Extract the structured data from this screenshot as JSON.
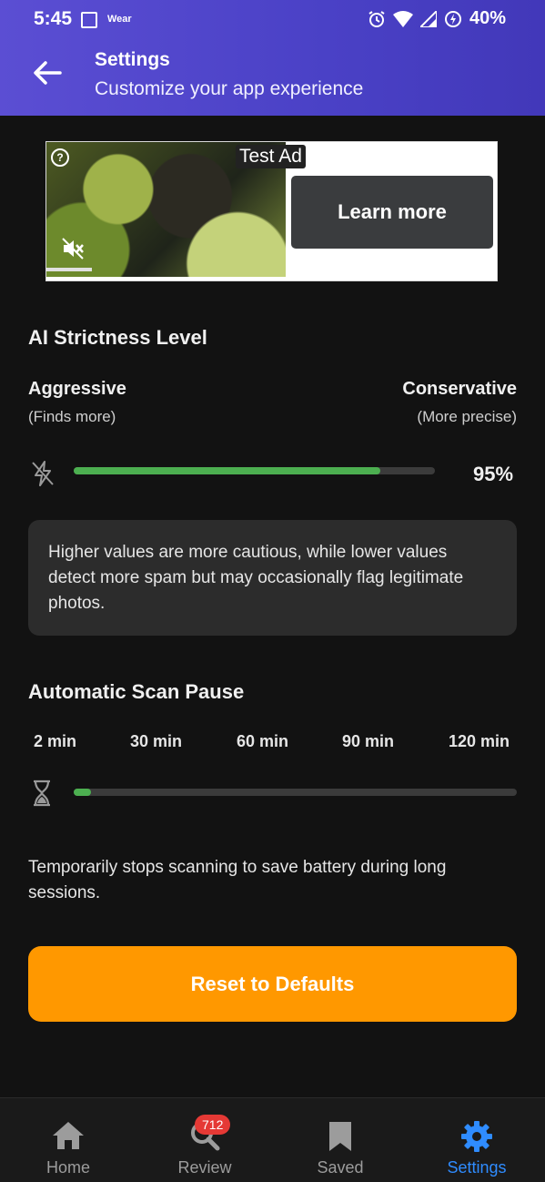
{
  "status_bar": {
    "time": "5:45",
    "wear_label": "Wear",
    "battery": "40%"
  },
  "header": {
    "title": "Settings",
    "subtitle": "Customize your app experience"
  },
  "ad": {
    "label": "Test Ad",
    "cta": "Learn more"
  },
  "strictness": {
    "title": "AI Strictness Level",
    "left_label": "Aggressive",
    "left_hint": "(Finds more)",
    "right_label": "Conservative",
    "right_hint": "(More precise)",
    "value_text": "95%",
    "value_fraction": 0.85,
    "info": "Higher values are more cautious, while lower values detect more spam but may occasionally flag legitimate photos."
  },
  "scan_pause": {
    "title": "Automatic Scan Pause",
    "ticks": [
      "2 min",
      "30 min",
      "60 min",
      "90 min",
      "120 min"
    ],
    "value_fraction": 0.04,
    "note": "Temporarily stops scanning to save battery during long sessions."
  },
  "reset_button": "Reset to Defaults",
  "bottom_nav": {
    "items": [
      {
        "label": "Home",
        "icon": "home-icon"
      },
      {
        "label": "Review",
        "icon": "search-icon",
        "badge": "712"
      },
      {
        "label": "Saved",
        "icon": "bookmark-icon"
      },
      {
        "label": "Settings",
        "icon": "gear-icon",
        "active": true
      }
    ]
  },
  "colors": {
    "accent": "#4a41c6",
    "slider_fill": "#4caf50",
    "reset": "#ff9800",
    "active_nav": "#2f8cff"
  }
}
